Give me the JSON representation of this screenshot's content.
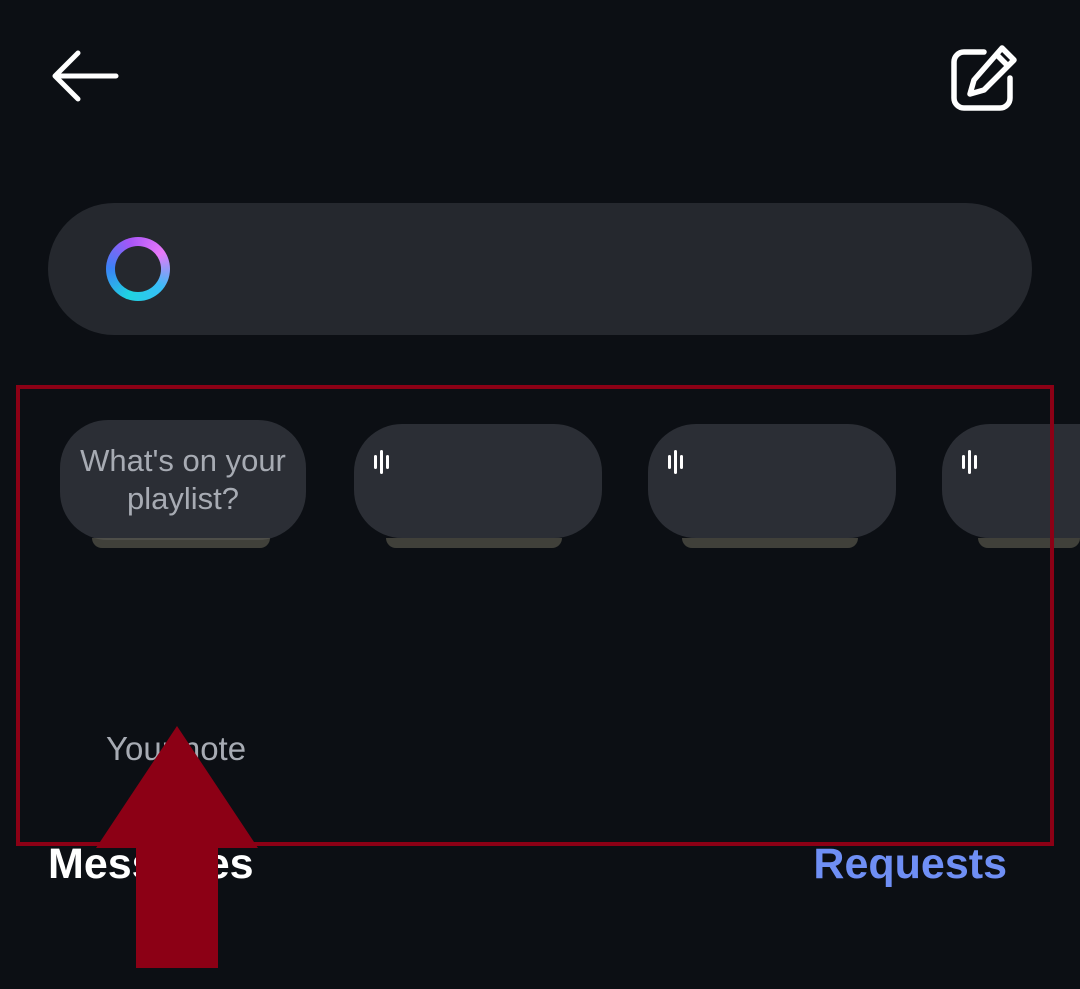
{
  "header": {
    "back_icon": "arrow-left-icon",
    "compose_icon": "edit-square-icon"
  },
  "search": {
    "ai_icon": "meta-ai-ring-icon",
    "placeholder": ""
  },
  "notes": {
    "own_note_prompt": "What's on your playlist?",
    "own_note_label": "Your note",
    "music_icon": "audio-wave-icon"
  },
  "inbox": {
    "title": "Messages",
    "requests_label": "Requests"
  },
  "colors": {
    "background": "#0c0f14",
    "surface": "#25282e",
    "bubble": "#2b2e35",
    "accent": "#6f8ff5",
    "highlight": "#8c0015"
  }
}
